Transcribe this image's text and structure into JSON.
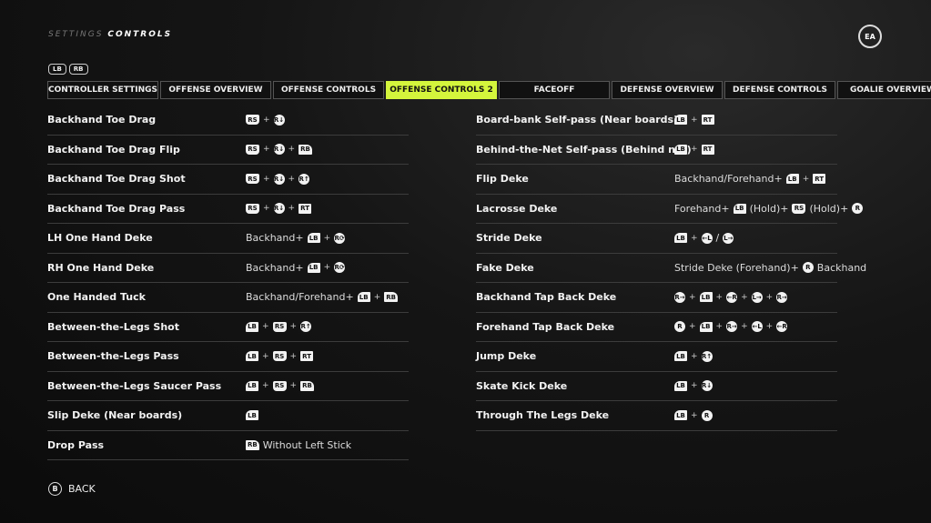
{
  "header": {
    "crumb_parent": "SETTINGS",
    "crumb_current": "CONTROLS",
    "logo": "EA SPORTS"
  },
  "bumpers": [
    "LB",
    "RB"
  ],
  "tabs": [
    {
      "label": "CONTROLLER SETTINGS"
    },
    {
      "label": "OFFENSE OVERVIEW"
    },
    {
      "label": "OFFENSE CONTROLS"
    },
    {
      "label": "OFFENSE CONTROLS 2",
      "active": true
    },
    {
      "label": "FACEOFF"
    },
    {
      "label": "DEFENSE OVERVIEW"
    },
    {
      "label": "DEFENSE CONTROLS"
    },
    {
      "label": "GOALIE OVERVIEW"
    }
  ],
  "accent": "#d4f53c",
  "icons": {
    "LB": {
      "name": "lb-button-icon",
      "label": "LB",
      "shape": "lb"
    },
    "RB": {
      "name": "rb-button-icon",
      "label": "RB",
      "shape": "rb"
    },
    "RT": {
      "name": "rt-trigger-icon",
      "label": "RT",
      "shape": "rt"
    },
    "RS": {
      "name": "dpad-stick-press-icon",
      "label": "RS",
      "shape": "pad"
    },
    "R↓": {
      "name": "right-stick-down-icon",
      "label": "R↓",
      "shape": "stick"
    },
    "R↑": {
      "name": "right-stick-up-icon",
      "label": "R↑",
      "shape": "stick"
    },
    "R⟳": {
      "name": "right-stick-rotate-icon",
      "label": "R⟳",
      "shape": "stick"
    },
    "R_": {
      "name": "right-stick-hold-icon",
      "label": "R",
      "shape": "stick"
    },
    "R": {
      "name": "right-stick-icon",
      "label": "R",
      "shape": "stick"
    },
    "R→": {
      "name": "right-stick-right-icon",
      "label": "R→",
      "shape": "stick"
    },
    "←R": {
      "name": "right-stick-left-icon",
      "label": "←R",
      "shape": "stick"
    },
    "L→": {
      "name": "left-stick-right-icon",
      "label": "L→",
      "shape": "stick"
    },
    "←L": {
      "name": "left-stick-left-icon",
      "label": "←L",
      "shape": "stick"
    }
  },
  "left": [
    {
      "label": "Backhand Toe Drag",
      "combo": [
        "RS",
        "+",
        "R↓"
      ]
    },
    {
      "label": "Backhand Toe Drag Flip",
      "combo": [
        "RS",
        "+",
        "R↓",
        "+",
        "RB"
      ]
    },
    {
      "label": "Backhand Toe Drag Shot",
      "combo": [
        "RS",
        "+",
        "R↓",
        "+",
        "R↑"
      ]
    },
    {
      "label": "Backhand Toe Drag Pass",
      "combo": [
        "RS",
        "+",
        "R↓",
        "+",
        "RT"
      ]
    },
    {
      "label": "LH One Hand Deke",
      "combo": [
        "Backhand+",
        "LB",
        "+",
        "R⟳"
      ]
    },
    {
      "label": "RH One Hand Deke",
      "combo": [
        "Backhand+",
        "LB",
        "+",
        "R⟳"
      ]
    },
    {
      "label": "One Handed Tuck",
      "combo": [
        "Backhand/Forehand+",
        "LB",
        "+",
        "RB"
      ]
    },
    {
      "label": "Between-the-Legs Shot",
      "combo": [
        "LB",
        "+",
        "RS",
        "+",
        "R↑"
      ]
    },
    {
      "label": "Between-the-Legs Pass",
      "combo": [
        "LB",
        "+",
        "RS",
        "+",
        "RT"
      ]
    },
    {
      "label": "Between-the-Legs Saucer Pass",
      "combo": [
        "LB",
        "+",
        "RS",
        "+",
        "RB"
      ]
    },
    {
      "label": "Slip Deke (Near boards)",
      "combo": [
        "LB"
      ]
    },
    {
      "label": "Drop Pass",
      "combo": [
        "RB",
        "Without Left Stick"
      ]
    }
  ],
  "right": [
    {
      "label": "Board-bank Self-pass (Near boards)",
      "combo": [
        "LB",
        "+",
        "RT"
      ]
    },
    {
      "label": "Behind-the-Net Self-pass (Behind net)",
      "combo": [
        "LB",
        "+",
        "RT"
      ]
    },
    {
      "label": "Flip Deke",
      "combo": [
        "Backhand/Forehand+",
        "LB",
        "+",
        "RT"
      ]
    },
    {
      "label": "Lacrosse Deke",
      "combo": [
        "Forehand+",
        "LB",
        "(Hold)+",
        "RS",
        "(Hold)+",
        "R_"
      ]
    },
    {
      "label": "Stride Deke",
      "combo": [
        "LB",
        "+",
        "←L",
        "/",
        "L→"
      ]
    },
    {
      "label": "Fake Deke",
      "combo": [
        "Stride Deke (Forehand)+",
        "R",
        "Backhand"
      ]
    },
    {
      "label": "Backhand Tap Back Deke",
      "combo": [
        "R→",
        "+",
        "LB",
        "+",
        "←R",
        "+",
        "L→",
        "+",
        "R→"
      ]
    },
    {
      "label": "Forehand Tap Back Deke",
      "combo": [
        "R_",
        "+",
        "LB",
        "+",
        "R→",
        "+",
        "←L",
        "+",
        "←R"
      ]
    },
    {
      "label": "Jump Deke",
      "combo": [
        "LB",
        "+",
        "R↑"
      ]
    },
    {
      "label": "Skate Kick Deke",
      "combo": [
        "LB",
        "+",
        "R↓"
      ]
    },
    {
      "label": "Through The Legs Deke",
      "combo": [
        "LB",
        "+",
        "R_"
      ]
    }
  ],
  "footer": {
    "back_key": "B",
    "back_label": "BACK"
  }
}
